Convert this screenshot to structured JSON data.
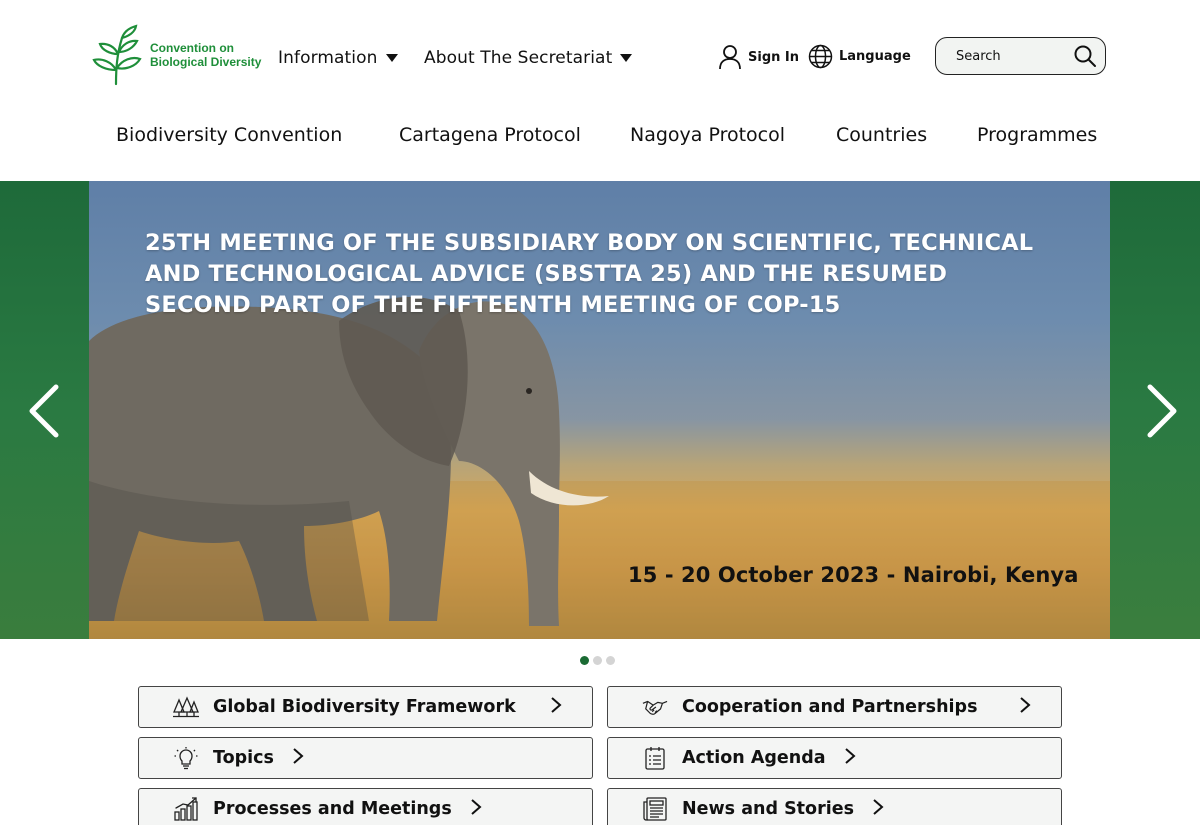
{
  "header": {
    "logo": {
      "line1": "Convention on",
      "line2": "Biological Diversity"
    },
    "menus": [
      {
        "label": "Information"
      },
      {
        "label": "About The Secretariat"
      }
    ],
    "sign_in": "Sign In",
    "language": "Language",
    "search": {
      "placeholder": "Search",
      "value": ""
    },
    "nav": [
      "Biodiversity Convention",
      "Cartagena Protocol",
      "Nagoya Protocol",
      "Countries",
      "Programmes"
    ]
  },
  "hero": {
    "title": "25th Meeting of the Subsidiary Body on Scientific, Technical and Technological Advice (SBSTTA 25) and the Resumed Second Part of the Fifteenth Meeting of COP-15",
    "date_location": "15 - 20 October 2023 - Nairobi, Kenya",
    "slide_count": 3,
    "active_slide": 1
  },
  "quick_links": [
    {
      "label": "Global Biodiversity Framework",
      "icon": "forest-icon"
    },
    {
      "label": "Cooperation and Partnerships",
      "icon": "handshake-icon"
    },
    {
      "label": "Topics",
      "icon": "lightbulb-icon"
    },
    {
      "label": "Action Agenda",
      "icon": "checklist-icon"
    },
    {
      "label": "Processes and Meetings",
      "icon": "bar-chart-icon"
    },
    {
      "label": "News and Stories",
      "icon": "newspaper-icon"
    }
  ],
  "colors": {
    "brand_green": "#1f8f3a",
    "hero_side_green": "#2a7a42",
    "active_dot": "#1b6b34",
    "inactive_dot": "#d4d4d4"
  }
}
